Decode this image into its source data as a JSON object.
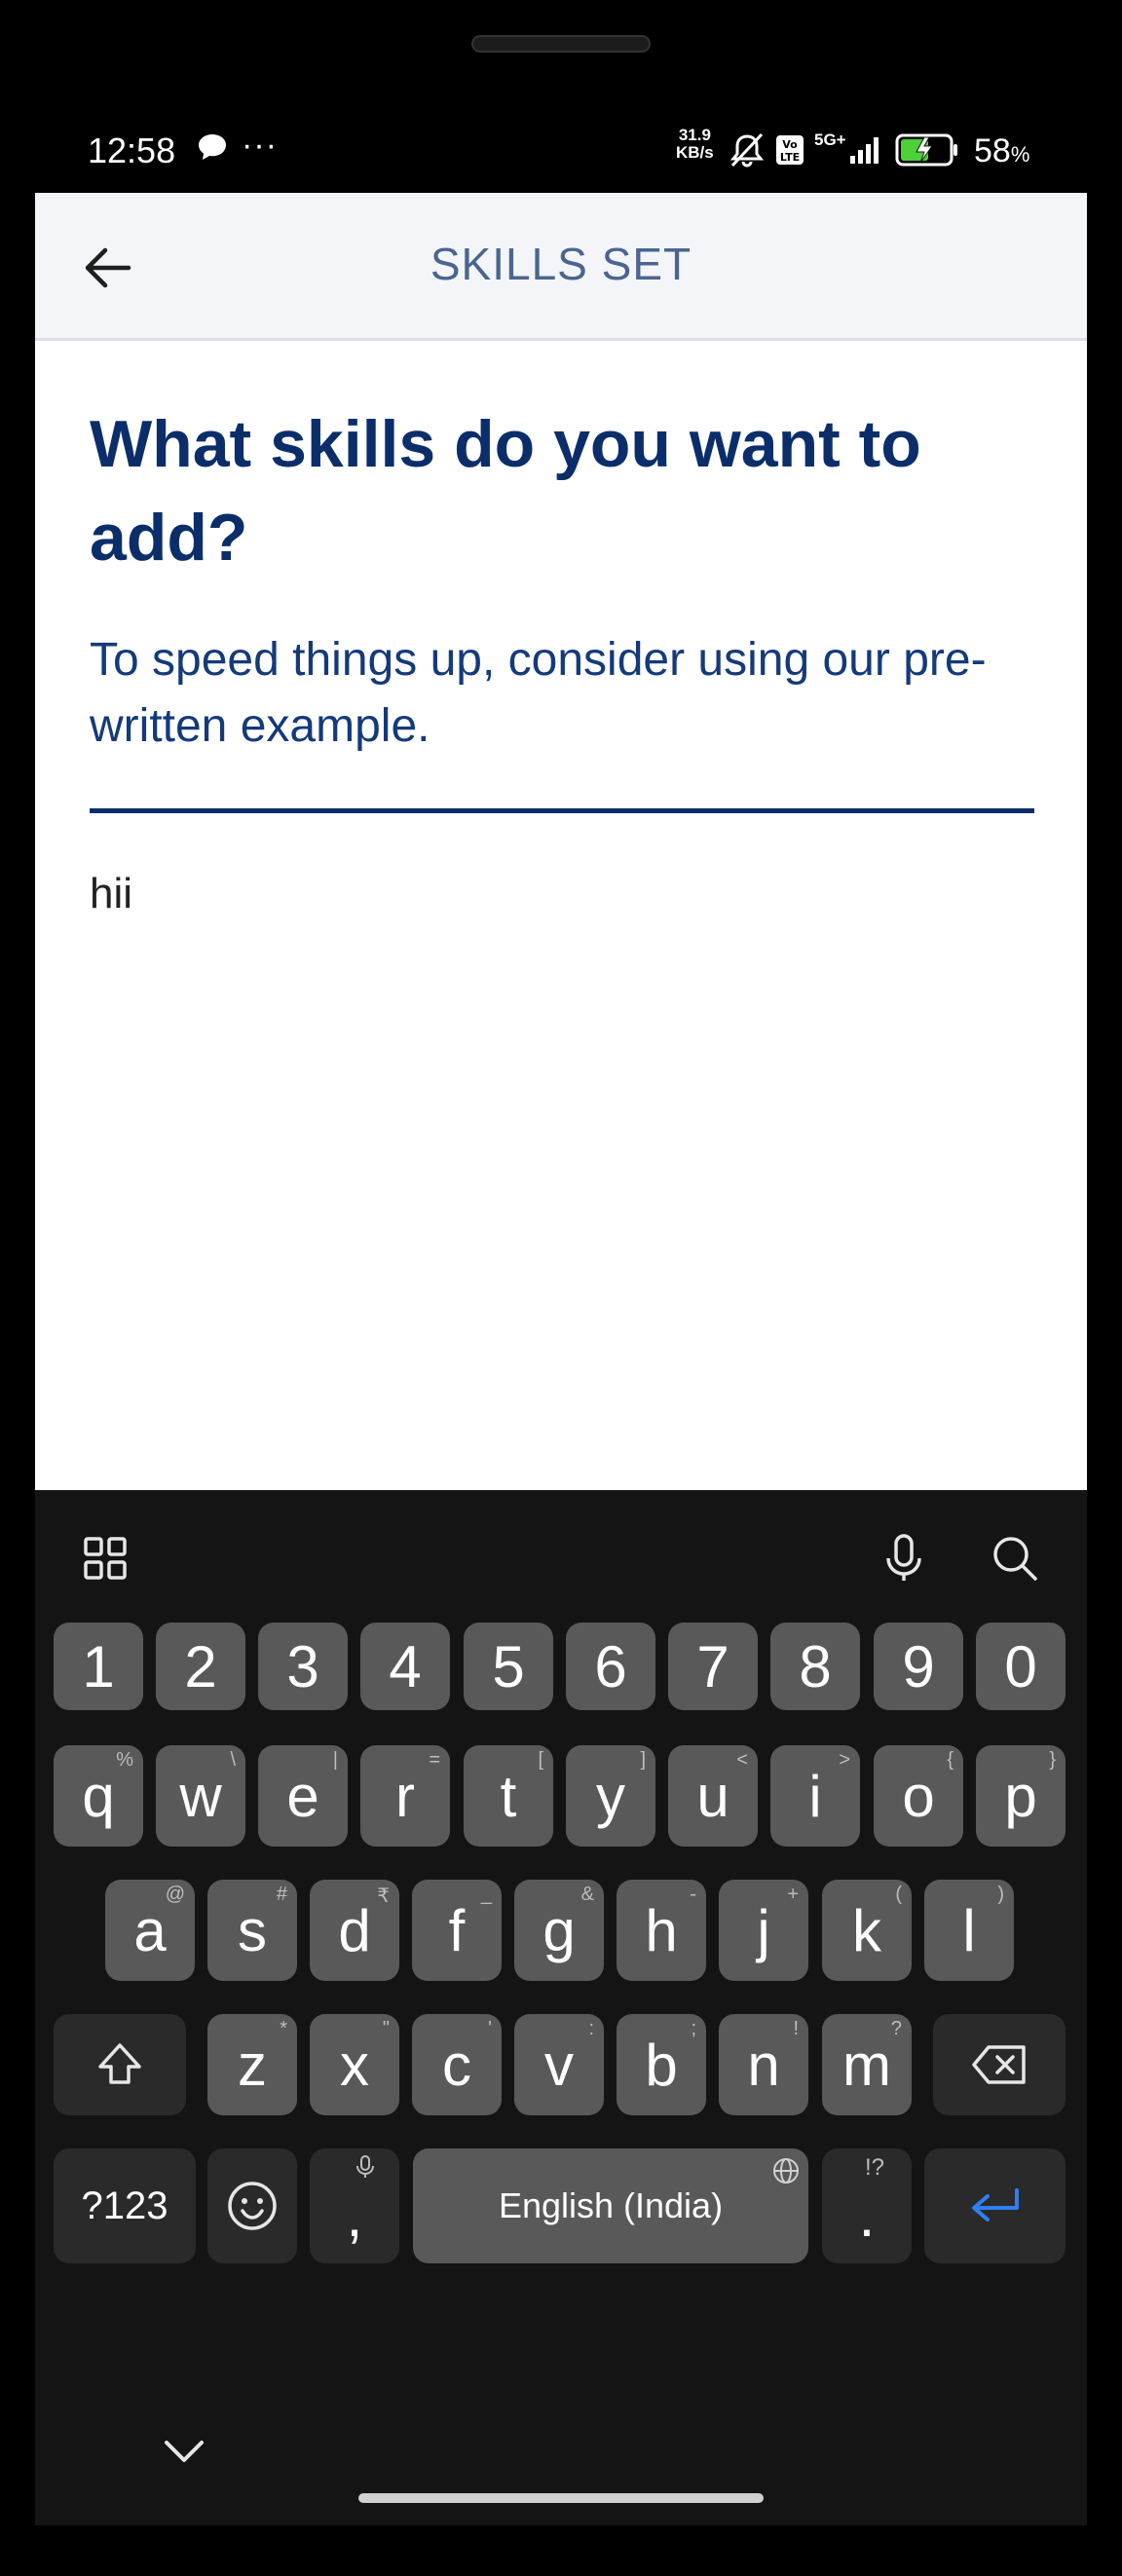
{
  "status_bar": {
    "time": "12:58",
    "overflow": "···",
    "speed_value": "31.9",
    "speed_unit": "KB/s",
    "network": "5G+",
    "battery": "58",
    "battery_unit": "%",
    "icons": [
      "chat-icon",
      "mute-icon",
      "volte-icon",
      "signal-icon",
      "battery-charging-icon"
    ]
  },
  "app_bar": {
    "title": "SKILLS SET"
  },
  "content": {
    "heading": "What skills do you want to add?",
    "subtext": "To speed things up, consider using our pre-written example.",
    "input_value": "hii"
  },
  "keyboard": {
    "number_row": [
      "1",
      "2",
      "3",
      "4",
      "5",
      "6",
      "7",
      "8",
      "9",
      "0"
    ],
    "row1": [
      {
        "key": "q",
        "hint": "%"
      },
      {
        "key": "w",
        "hint": "\\"
      },
      {
        "key": "e",
        "hint": "|"
      },
      {
        "key": "r",
        "hint": "="
      },
      {
        "key": "t",
        "hint": "["
      },
      {
        "key": "y",
        "hint": "]"
      },
      {
        "key": "u",
        "hint": "<"
      },
      {
        "key": "i",
        "hint": ">"
      },
      {
        "key": "o",
        "hint": "{"
      },
      {
        "key": "p",
        "hint": "}"
      }
    ],
    "row2": [
      {
        "key": "a",
        "hint": "@"
      },
      {
        "key": "s",
        "hint": "#"
      },
      {
        "key": "d",
        "hint": "₹"
      },
      {
        "key": "f",
        "hint": "_"
      },
      {
        "key": "g",
        "hint": "&"
      },
      {
        "key": "h",
        "hint": "-"
      },
      {
        "key": "j",
        "hint": "+"
      },
      {
        "key": "k",
        "hint": "("
      },
      {
        "key": "l",
        "hint": ")"
      }
    ],
    "row3": [
      {
        "key": "z",
        "hint": "*"
      },
      {
        "key": "x",
        "hint": "\""
      },
      {
        "key": "c",
        "hint": "'"
      },
      {
        "key": "v",
        "hint": ":"
      },
      {
        "key": "b",
        "hint": ";"
      },
      {
        "key": "n",
        "hint": "!"
      },
      {
        "key": "m",
        "hint": "?"
      }
    ],
    "symbols_label": "?123",
    "comma": ",",
    "space_label": "English (India)",
    "period": ".",
    "period_hint": "!?"
  }
}
